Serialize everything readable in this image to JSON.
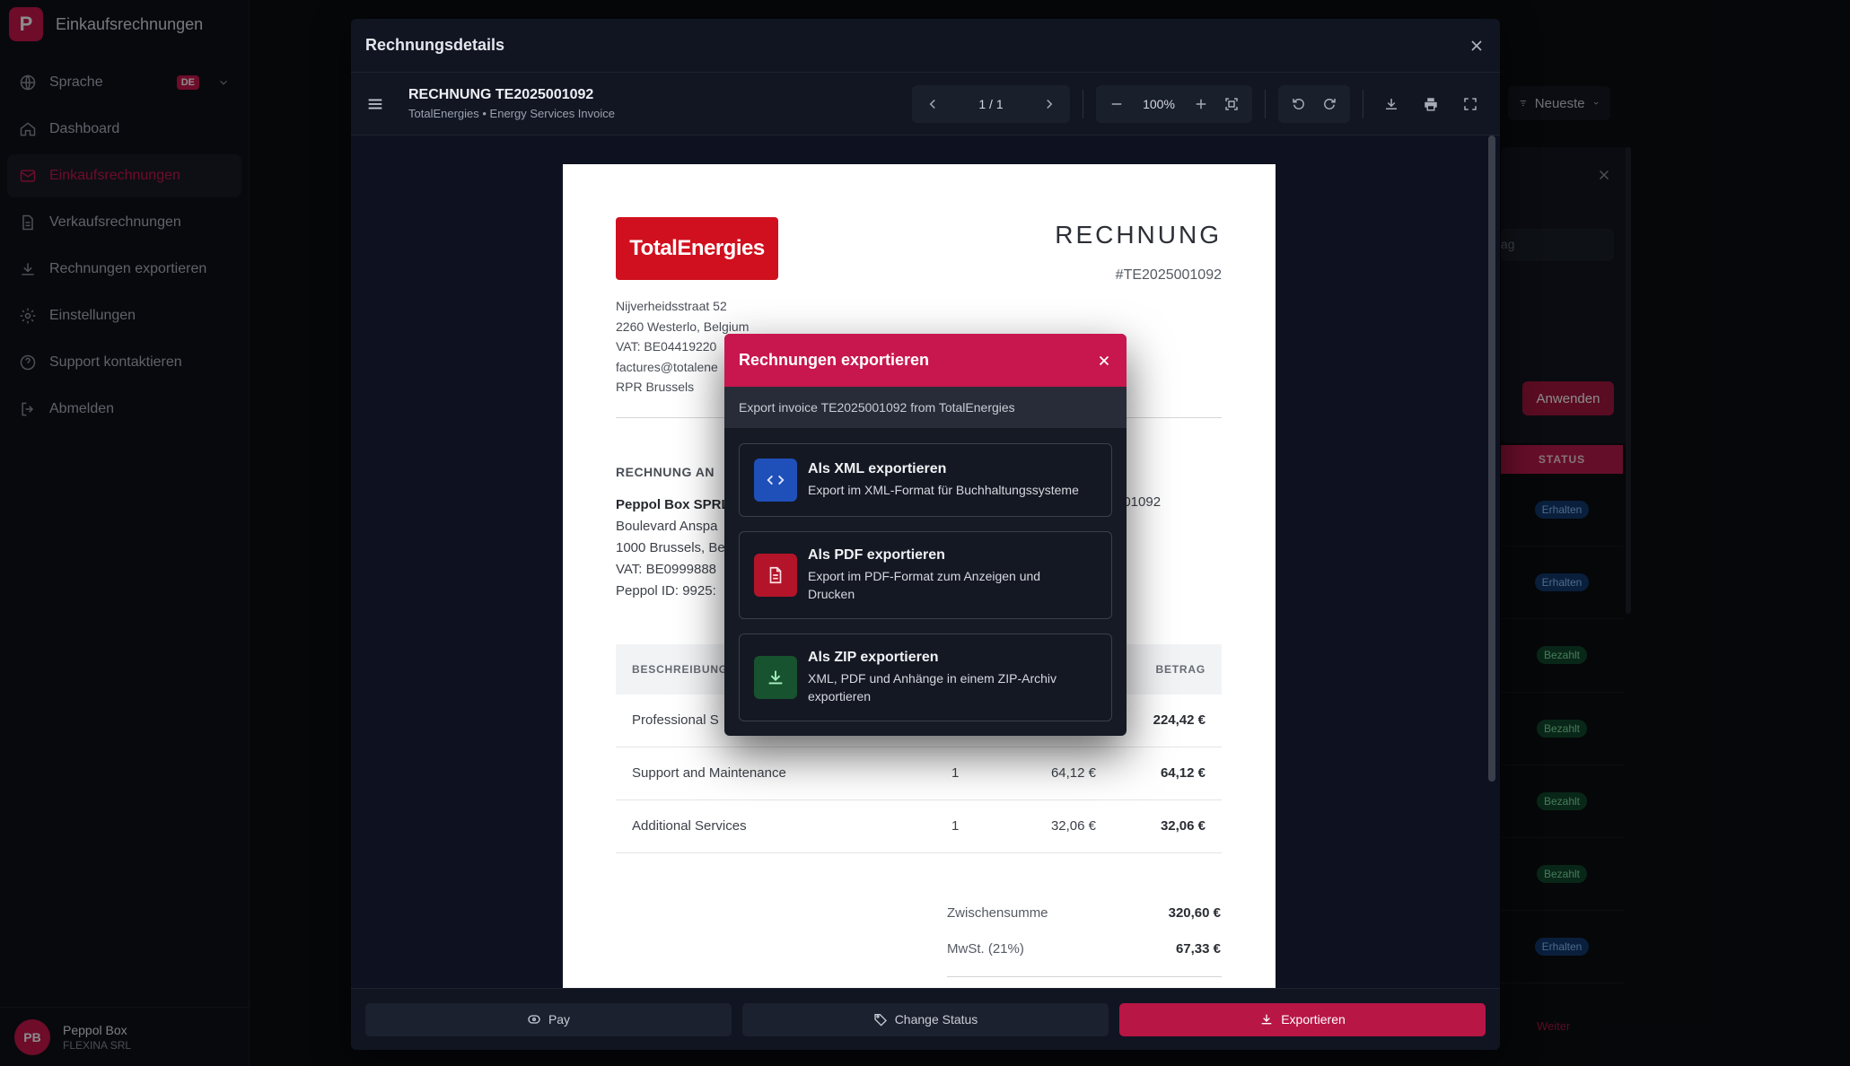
{
  "sidebar": {
    "brand_letter": "P",
    "brand_title": "Einkaufsrechnungen",
    "items": [
      {
        "label": "Sprache",
        "icon": "globe-icon",
        "badge": "DE"
      },
      {
        "label": "Dashboard",
        "icon": "home-icon"
      },
      {
        "label": "Einkaufsrechnungen",
        "icon": "mail-icon",
        "active": true
      },
      {
        "label": "Verkaufsrechnungen",
        "icon": "document-icon"
      },
      {
        "label": "Rechnungen exportieren",
        "icon": "download-icon"
      },
      {
        "label": "Einstellungen",
        "icon": "gear-icon"
      },
      {
        "label": "Support kontaktieren",
        "icon": "help-icon"
      },
      {
        "label": "Abmelden",
        "icon": "logout-icon"
      }
    ],
    "user": {
      "initials": "PB",
      "name": "Peppol Box",
      "org": "FLEXINA SRL"
    }
  },
  "background": {
    "sort_label": "Neueste",
    "filter_placeholder": "ag",
    "apply_label": "Anwenden",
    "status_header": "STATUS",
    "statuses": [
      "Erhalten",
      "Erhalten",
      "Bezahlt",
      "Bezahlt",
      "Bezahlt",
      "Bezahlt",
      "Erhalten"
    ],
    "next_label": "Weiter"
  },
  "invoice_modal": {
    "title": "Rechnungsdetails",
    "doc_title": "RECHNUNG TE2025001092",
    "doc_subtitle": "TotalEnergies • Energy Services Invoice",
    "page_indicator": "1 / 1",
    "zoom": "100%",
    "footer": {
      "pay": "Pay",
      "change_status": "Change Status",
      "export": "Exportieren"
    }
  },
  "invoice": {
    "logo_text": "TotalEnergies",
    "heading": "RECHNUNG",
    "number": "#TE2025001092",
    "sender": [
      "Nijverheidsstraat 52",
      "2260 Westerlo, Belgium",
      "VAT: BE04419220",
      "factures@totalene",
      "RPR Brussels"
    ],
    "bill_to_heading": "RECHNUNG AN",
    "bill_to": [
      "Peppol Box SPRL",
      "Boulevard Anspa",
      "1000 Brussels, Be",
      "VAT: BE0999888",
      "Peppol ID: 9925:"
    ],
    "ref_fragment": "001092",
    "table": {
      "header_desc": "BESCHREIBUNG",
      "header_amount": "BETRAG",
      "rows": [
        {
          "desc": "Professional S",
          "qty": "",
          "price": "",
          "amount": "224,42 €"
        },
        {
          "desc": "Support and Maintenance",
          "qty": "1",
          "price": "64,12 €",
          "amount": "64,12 €"
        },
        {
          "desc": "Additional Services",
          "qty": "1",
          "price": "32,06 €",
          "amount": "32,06 €"
        }
      ]
    },
    "subtotal_label": "Zwischensumme",
    "subtotal": "320,60 €",
    "vat_label": "MwSt. (21%)",
    "vat": "67,33 €"
  },
  "export_dialog": {
    "title": "Rechnungen exportieren",
    "subtitle": "Export invoice TE2025001092 from TotalEnergies",
    "options": [
      {
        "title": "Als XML exportieren",
        "desc": "Export im XML-Format für Buchhaltungssysteme",
        "icon": "code-icon"
      },
      {
        "title": "Als PDF exportieren",
        "desc": "Export im PDF-Format zum Anzeigen und Drucken",
        "icon": "file-icon"
      },
      {
        "title": "Als ZIP exportieren",
        "desc": "XML, PDF und Anhänge in einem ZIP-Archiv exportieren",
        "icon": "download-icon"
      }
    ]
  },
  "colors": {
    "accent": "#c8174e",
    "background": "#0b0d12",
    "logo_red": "#d0101e"
  }
}
